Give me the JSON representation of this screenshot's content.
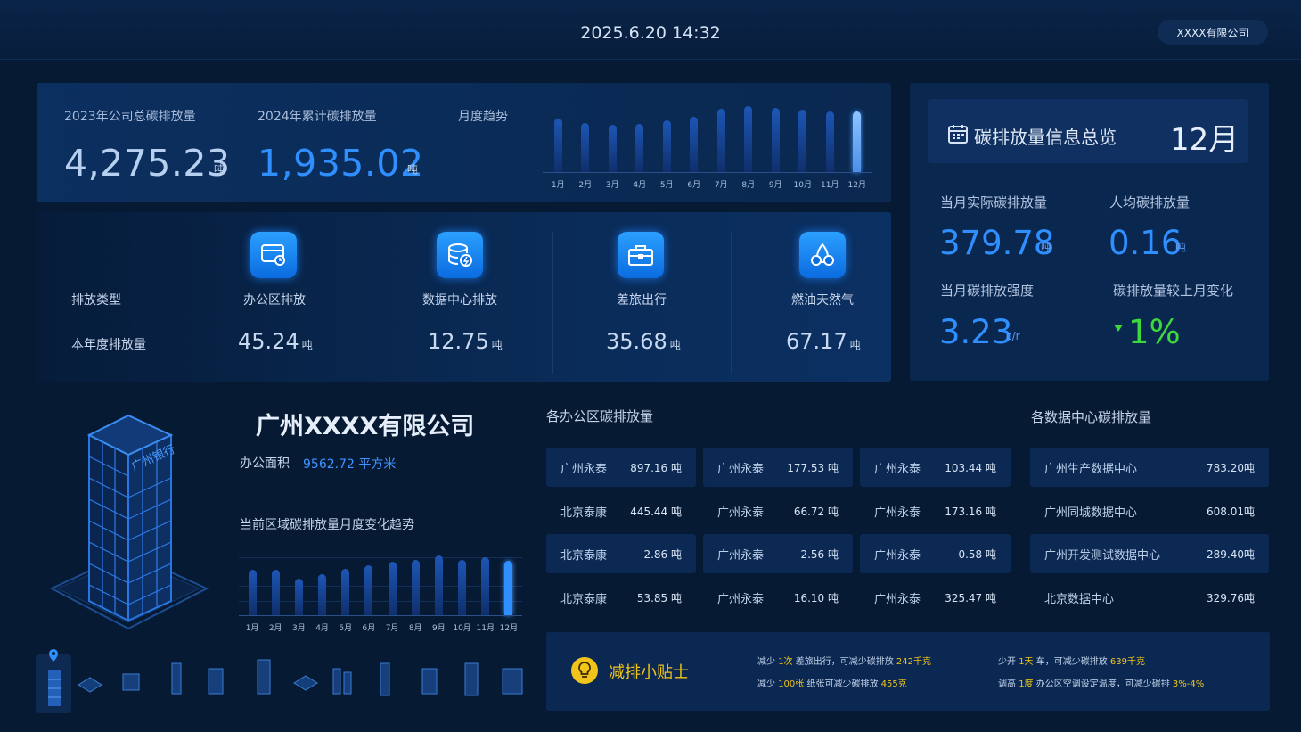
{
  "header": {
    "datetime": "2025.6.20 14:32",
    "company_button": "XXXX有限公司"
  },
  "summary": {
    "total_2023_label": "2023年公司总碳排放量",
    "total_2023_value": "4,275.23",
    "total_2023_unit": "吨",
    "cum_2024_label": "2024年累计碳排放量",
    "cum_2024_value": "1,935.02",
    "cum_2024_unit": "吨",
    "trend_label": "月度趋势"
  },
  "chart_data": [
    {
      "type": "bar",
      "title": "月度趋势",
      "categories": [
        "1月",
        "2月",
        "3月",
        "4月",
        "5月",
        "6月",
        "7月",
        "8月",
        "9月",
        "10月",
        "11月",
        "12月"
      ],
      "values": [
        60,
        55,
        53,
        54,
        58,
        62,
        71,
        74,
        72,
        70,
        68,
        68
      ],
      "highlight_index": 11,
      "color": "#1d56b5",
      "highlight_color": "#8fc4ff"
    },
    {
      "type": "bar",
      "title": "当前区域碳排放量月度变化趋势",
      "categories": [
        "1月",
        "2月",
        "3月",
        "4月",
        "5月",
        "6月",
        "7月",
        "8月",
        "9月",
        "10月",
        "11月",
        "12月"
      ],
      "values": [
        45,
        45,
        36,
        41,
        46,
        50,
        53,
        55,
        59,
        55,
        58,
        54
      ],
      "highlight_index": 11,
      "color": "#1d56b5",
      "highlight_color": "#2f8fff"
    }
  ],
  "categories": {
    "row1_label": "排放类型",
    "row2_label": "本年度排放量",
    "items": [
      {
        "name": "办公区排放",
        "value": "45.24",
        "unit": "吨",
        "icon": "office-screen-icon"
      },
      {
        "name": "数据中心排放",
        "value": "12.75",
        "unit": "吨",
        "icon": "database-icon"
      },
      {
        "name": "差旅出行",
        "value": "35.68",
        "unit": "吨",
        "icon": "briefcase-icon"
      },
      {
        "name": "燃油天然气",
        "value": "67.17",
        "unit": "吨",
        "icon": "fuel-gas-icon"
      }
    ]
  },
  "overview": {
    "title": "碳排放量信息总览",
    "month": "12月",
    "actual_label": "当月实际碳排放量",
    "actual_value": "379.78",
    "actual_unit": "吨",
    "per_capita_label": "人均碳排放量",
    "per_capita_value": "0.16",
    "per_capita_unit": "吨",
    "intensity_label": "当月碳排放强度",
    "intensity_value": "3.23",
    "intensity_unit": "c/r",
    "change_label": "碳排放量较上月变化",
    "change_value": "1%",
    "change_color": "#3dd83d"
  },
  "company": {
    "name": "广州XXXX有限公司",
    "area_label": "办公面积",
    "area_value": "9562.72 平方米",
    "building_sign": "广州银行",
    "trend_title": "当前区域碳排放量月度变化趋势"
  },
  "offices": {
    "title": "各办公区碳排放量",
    "rows": [
      [
        {
          "name": "广州永泰",
          "value": "897.16 吨"
        },
        {
          "name": "广州永泰",
          "value": "177.53 吨"
        },
        {
          "name": "广州永泰",
          "value": "103.44 吨"
        }
      ],
      [
        {
          "name": "北京泰康",
          "value": "445.44 吨"
        },
        {
          "name": "广州永泰",
          "value": "66.72 吨"
        },
        {
          "name": "广州永泰",
          "value": "173.16 吨"
        }
      ],
      [
        {
          "name": "北京泰康",
          "value": "2.86 吨"
        },
        {
          "name": "广州永泰",
          "value": "2.56 吨"
        },
        {
          "name": "广州永泰",
          "value": "0.58 吨"
        }
      ],
      [
        {
          "name": "北京泰康",
          "value": "53.85 吨"
        },
        {
          "name": "广州永泰",
          "value": "16.10 吨"
        },
        {
          "name": "广州永泰",
          "value": "325.47 吨"
        }
      ]
    ]
  },
  "datacenters": {
    "title": "各数据中心碳排放量",
    "rows": [
      {
        "name": "广州生产数据中心",
        "value": "783.20吨"
      },
      {
        "name": "广州同城数据中心",
        "value": "608.01吨"
      },
      {
        "name": "广州开发测试数据中心",
        "value": "289.40吨"
      },
      {
        "name": "北京数据中心",
        "value": "329.76吨"
      }
    ]
  },
  "tips": {
    "title": "减排小贴士",
    "t1": {
      "a": "减少 ",
      "b": "1次",
      "c": " 差旅出行，可减少碳排放 ",
      "d": "242千克"
    },
    "t2": {
      "a": "减少 ",
      "b": "100张",
      "c": " 纸张可减少碳排放 ",
      "d": "455克"
    },
    "t3": {
      "a": "少开 ",
      "b": "1天",
      "c": " 车，可减少碳排放 ",
      "d": "639千克"
    },
    "t4": {
      "a": "调高 ",
      "b": "1度",
      "c": " 办公区空调设定温度，可减少碳排 ",
      "d": "3%-4%"
    }
  }
}
